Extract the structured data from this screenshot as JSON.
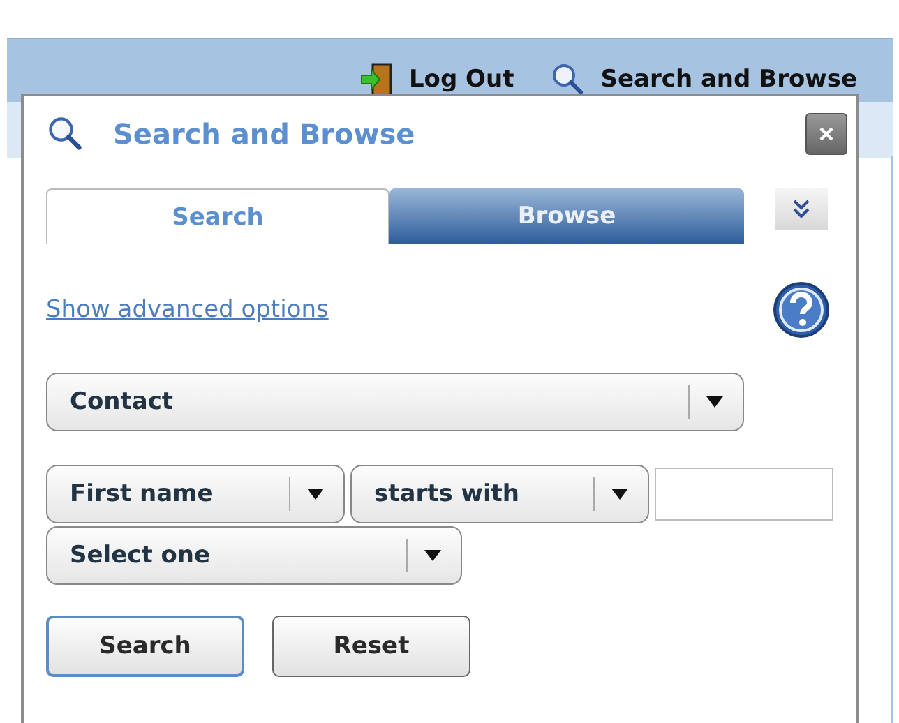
{
  "header": {
    "links": [
      {
        "kind": "logout",
        "label": "Log Out"
      },
      {
        "kind": "search",
        "label": "Search and Browse"
      }
    ]
  },
  "dialog": {
    "title": "Search and Browse",
    "tabs": [
      {
        "label": "Search",
        "selected": true
      },
      {
        "label": "Browse",
        "selected": false
      }
    ],
    "advanced_link": "Show advanced options",
    "object_select": {
      "value": "Contact"
    },
    "criteria": {
      "field": "First name",
      "operator": "starts with",
      "connector": "Select one"
    },
    "buttons": [
      {
        "label": "Search",
        "focused": true
      },
      {
        "label": "Reset",
        "focused": false
      }
    ]
  }
}
